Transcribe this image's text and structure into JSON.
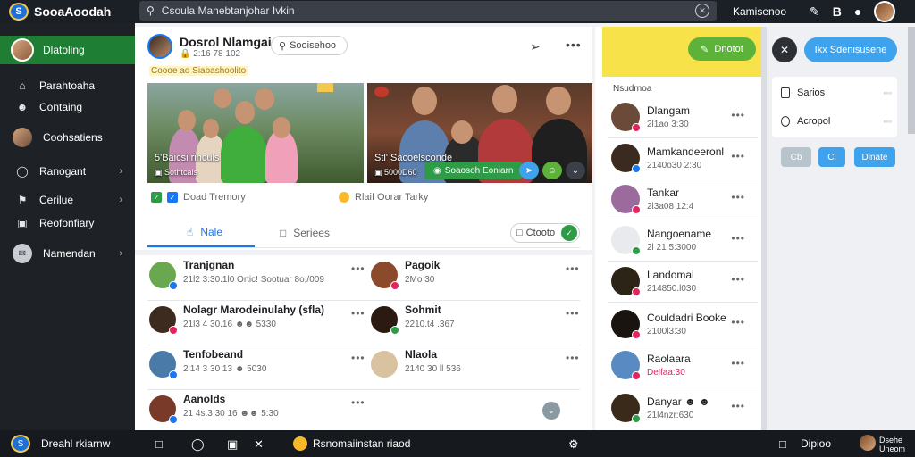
{
  "app": {
    "logo_glyph": "S",
    "name": "SooaAoodah"
  },
  "search": {
    "placeholder": "Csoula Manebtanjohar Ivkin"
  },
  "topbar": {
    "username": "Kamisenoo"
  },
  "sidebar": {
    "active": {
      "label": "Dlatoling"
    },
    "items": [
      {
        "label": "Parahtoaha",
        "icon": "home-icon",
        "has_chevron": false
      },
      {
        "label": "Containg",
        "icon": "user-icon",
        "has_chevron": false
      },
      {
        "label": "Coohsatiens",
        "icon": "avatar-icon",
        "has_chevron": false
      },
      {
        "label": "Ranogant",
        "icon": "compass-icon",
        "has_chevron": true
      },
      {
        "label": "Cerilue",
        "icon": "flag-icon",
        "has_chevron": true
      },
      {
        "label": "Reofonfiary",
        "icon": "bookmark-icon",
        "has_chevron": false
      },
      {
        "label": "Namendan",
        "icon": "chat-icon",
        "has_chevron": true
      }
    ]
  },
  "post": {
    "author": "Dosrol Nlamgai",
    "time": "2:16 78 102",
    "subtitle": "Coooe ao Siabashoolito",
    "search_label": "Sooisehoo",
    "photo_left": {
      "caption": "5'Baicsi rinculs",
      "meta": "Sothtcals"
    },
    "photo_right": {
      "caption": "Stl' Sacoelsconde",
      "meta": "5000D60",
      "button_label": "Soaosoh Eoniarn"
    },
    "reaction_left": "Doad Tremory",
    "reaction_right": "Rlaif  Oorar Tarky",
    "tabs": {
      "like": "Nale",
      "share": "Seriees",
      "cta": "Ctooto"
    }
  },
  "comments": [
    {
      "name": "Tranjgnan",
      "meta": "21l2 3:30.1l0 Ortic! Sootuar 8o,/009",
      "color": "#6aa84f"
    },
    {
      "name": "Pagoik",
      "meta": "2Mo 30",
      "color": "#8b4a2b"
    },
    {
      "name": "Nolagr Marodeinulahy (sfla)",
      "meta": "21l3 4 30.16 ☻☻ 5330",
      "color": "#3d2b1f"
    },
    {
      "name": "Sohmit",
      "meta": "2210.t4 .367",
      "color": "#2a1a12"
    },
    {
      "name": "Tenfobeand",
      "meta": "2l14 3 30 13 ☻ 5030",
      "color": "#4a7aa8"
    },
    {
      "name": "Nlaola",
      "meta": "2140 30 ll 536",
      "color": "#d9c2a0"
    },
    {
      "name": "Aanolds",
      "meta": "21 4s.3 30 16 ☻☻ 5:30",
      "color": "#7a3a2a"
    }
  ],
  "friends": {
    "online_label": "Dnotot",
    "title": "Nsudrnoa",
    "list": [
      {
        "name": "Dlangam",
        "meta": "2l1ao 3:30",
        "color": "#6b4a3a",
        "badge": "#e0245e"
      },
      {
        "name": "Mamkandeeronl",
        "meta": "2140o30 2:30",
        "color": "#3a2a20",
        "badge": "#1877f2"
      },
      {
        "name": "Tankar",
        "meta": "2l3a08 12:4",
        "color": "#9c6b9e",
        "badge": "#e0245e"
      },
      {
        "name": "Nangoename",
        "meta": "2l 21 5:3000",
        "color": "#f5f6f7",
        "badge": "#2e9b47"
      },
      {
        "name": "Landomal",
        "meta": "214850.l030",
        "color": "#2d2418",
        "badge": "#e0245e"
      },
      {
        "name": "Couldadri Booke",
        "meta": "2100l3:30",
        "color": "#1a1410",
        "badge": "#e0245e"
      },
      {
        "name": "Raolaara",
        "meta": "Delfaa:30",
        "color": "#5a8ac2",
        "badge": "#e0245e"
      },
      {
        "name": "Danyar ☻ ☻",
        "meta": "21l4nzr:630",
        "color": "#3a2a1a",
        "badge": "#2e9b47"
      }
    ]
  },
  "panel": {
    "primary_button": "Ikx Sdenisusene",
    "rows": [
      {
        "label": "Sarios"
      },
      {
        "label": "Acropol"
      }
    ],
    "small_buttons": [
      "Cb",
      "Cl",
      "Dinate"
    ]
  },
  "bottombar": {
    "name": "Dreahl rkiarnw",
    "status_text": "Rsnomaiinstan riaod",
    "right_label": "Dipioo",
    "right_user": "Dsehe Uneom"
  },
  "colors": {
    "brand": "#1f6fd8",
    "active": "#1e7e34",
    "accent": "#1877f2"
  }
}
